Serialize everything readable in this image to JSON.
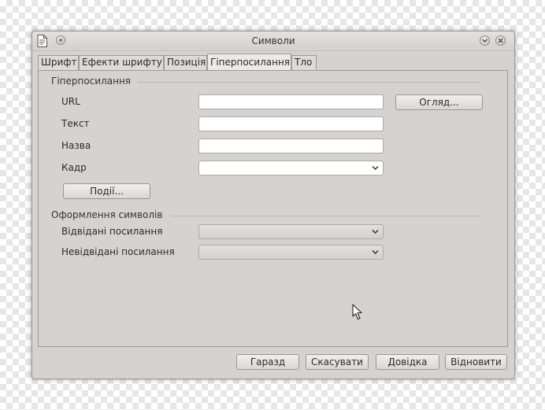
{
  "window": {
    "title": "Символи"
  },
  "tabs": [
    {
      "label": "Шрифт",
      "active": false
    },
    {
      "label": "Ефекти шрифту",
      "active": false
    },
    {
      "label": "Позиція",
      "active": false
    },
    {
      "label": "Гіперпосилання",
      "active": true
    },
    {
      "label": "Тло",
      "active": false
    }
  ],
  "hyperlink": {
    "section_title": "Гіперпосилання",
    "url_label": "URL",
    "url_value": "",
    "text_label": "Текст",
    "text_value": "",
    "name_label": "Назва",
    "name_value": "",
    "frame_label": "Кадр",
    "frame_value": "",
    "browse_button": "Огляд...",
    "events_button": "Події..."
  },
  "character_styles": {
    "section_title": "Оформлення символів",
    "visited_label": "Відвідані посилання",
    "visited_value": "",
    "unvisited_label": "Невідвідані посилання",
    "unvisited_value": ""
  },
  "footer": {
    "ok_label": "Гаразд",
    "cancel_label": "Скасувати",
    "help_label": "Довідка",
    "reset_label": "Відновити"
  },
  "icons": {
    "app": "document-icon",
    "pin": "pin-icon",
    "minimize": "chevron-down-icon",
    "close": "close-icon",
    "dropdown": "chevron-down-icon",
    "cursor": "mouse-pointer-icon"
  }
}
